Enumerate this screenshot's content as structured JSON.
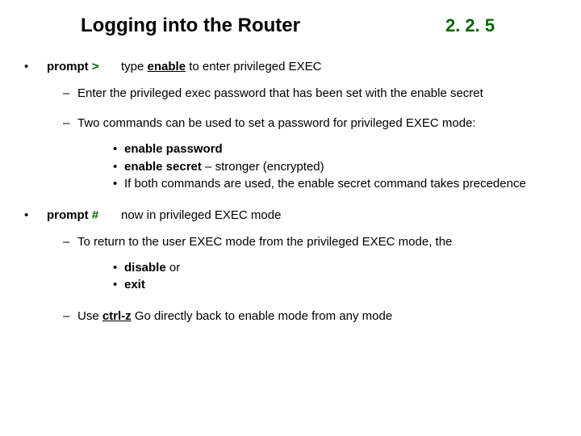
{
  "header": {
    "title": "Logging into the Router",
    "section": "2. 2. 5"
  },
  "items": [
    {
      "prompt_word": "prompt ",
      "prompt_sym": ">",
      "desc_pre": "type ",
      "desc_kw": "enable",
      "desc_post": " to enter privileged EXEC",
      "subs": [
        {
          "text": "Enter the privileged exec password that has been set with the enable secret"
        },
        {
          "text": "Two commands can be used to set a password for privileged EXEC mode:",
          "subsubs": [
            {
              "bold": "enable password",
              "tail": ""
            },
            {
              "bold": "enable secret",
              "tail": " – stronger (encrypted)"
            },
            {
              "bold": "",
              "tail": "If both commands are used, the enable secret command takes precedence"
            }
          ]
        }
      ]
    },
    {
      "prompt_word": "prompt ",
      "prompt_sym": "#",
      "desc_pre": "",
      "desc_kw": "",
      "desc_post": "now in privileged EXEC mode",
      "subs": [
        {
          "text": "To return to the user EXEC mode from the privileged EXEC mode, the",
          "subsubs": [
            {
              "bold": "disable",
              "tail": " or"
            },
            {
              "bold": "exit",
              "tail": ""
            }
          ]
        },
        {
          "rich_pre": "Use ",
          "rich_kw": "ctrl-z",
          "rich_post": " Go directly back to enable mode from any mode"
        }
      ]
    }
  ]
}
